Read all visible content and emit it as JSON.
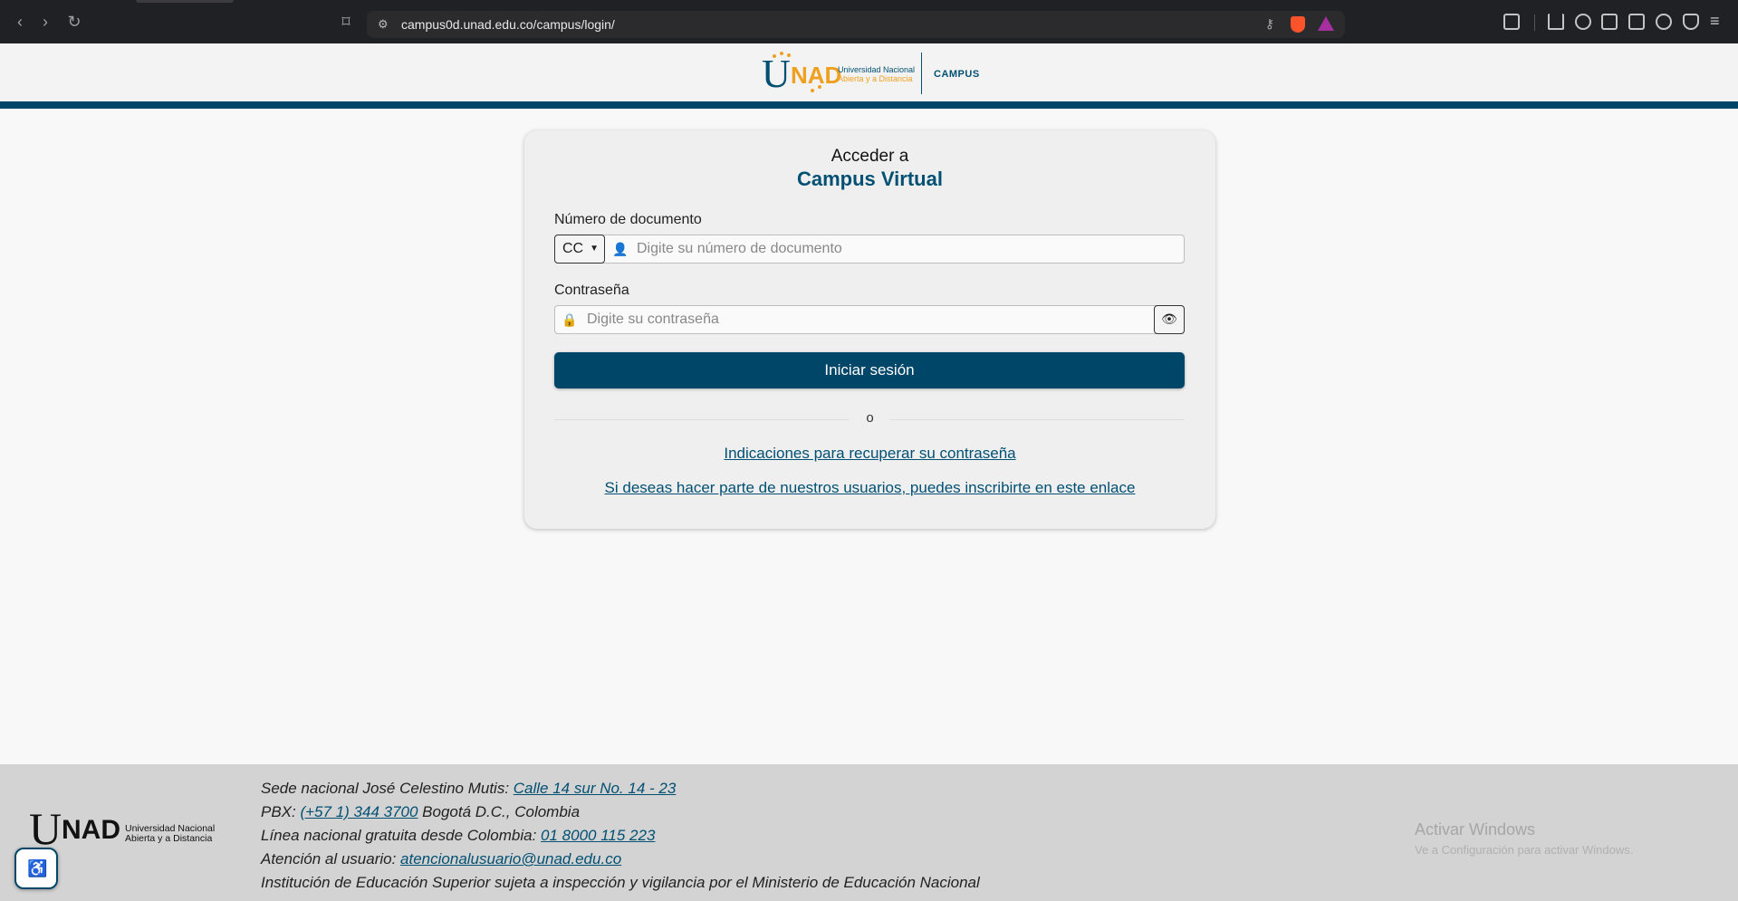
{
  "browser": {
    "url": "campus0d.unad.edu.co/campus/login/"
  },
  "header": {
    "logo_u": "U",
    "logo_ad": "NAD",
    "logo_name_line1": "Universidad Nacional",
    "logo_name_line2": "Abierta y a Distancia",
    "section": "CAMPUS"
  },
  "login": {
    "heading_line1": "Acceder a",
    "heading_line2": "Campus Virtual",
    "document_label": "Número de documento",
    "document_type": "CC",
    "document_placeholder": "Digite su número de documento",
    "password_label": "Contraseña",
    "password_placeholder": "Digite su contraseña",
    "submit_label": "Iniciar sesión",
    "or_text": "o",
    "recover_link": "Indicaciones para recuperar su contraseña",
    "register_link": "Si deseas hacer parte de nuestros usuarios, puedes inscribirte en este enlace"
  },
  "footer": {
    "logo_name_line1": "Universidad Nacional",
    "logo_name_line2": "Abierta y a Distancia",
    "sede_prefix": "Sede nacional José Celestino Mutis: ",
    "sede_link": "Calle 14 sur No. 14 - 23",
    "pbx_prefix": "PBX: ",
    "pbx_link": "(+57 1) 344 3700",
    "pbx_suffix": " Bogotá D.C., Colombia",
    "linea_prefix": "Línea nacional gratuita desde Colombia: ",
    "linea_link": "01 8000 115 223",
    "atencion_prefix": "Atención al usuario: ",
    "atencion_link": "atencionalusuario@unad.edu.co",
    "institucion": "Institución de Educación Superior sujeta a inspección y vigilancia por el Ministerio de Educación Nacional"
  },
  "windows_watermark": {
    "title": "Activar Windows",
    "subtitle": "Ve a Configuración para activar Windows."
  },
  "colors": {
    "primary": "#004669",
    "accent": "#f0a020"
  }
}
